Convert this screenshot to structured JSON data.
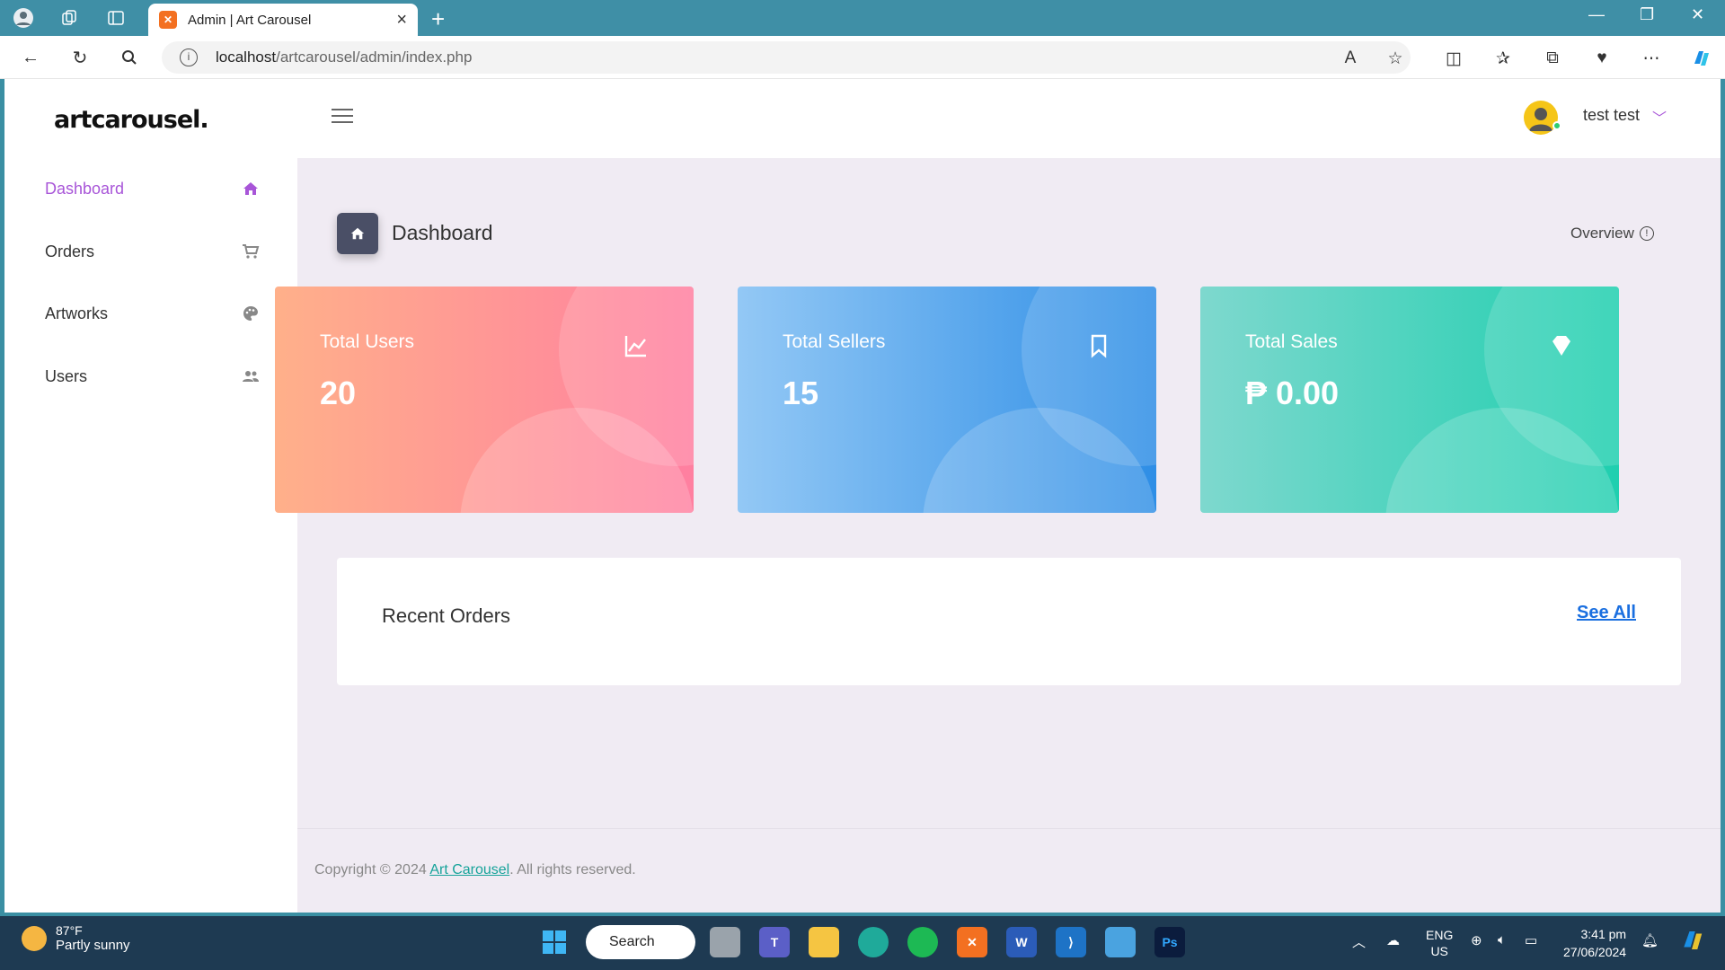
{
  "browser": {
    "tab_title": "Admin | Art Carousel",
    "url_host": "localhost",
    "url_path": "/artcarousel/admin/index.php"
  },
  "sidebar": {
    "logo": "artcarousel.",
    "items": [
      {
        "label": "Dashboard",
        "icon": "home-icon",
        "active": true
      },
      {
        "label": "Orders",
        "icon": "cart-icon",
        "active": false
      },
      {
        "label": "Artworks",
        "icon": "palette-icon",
        "active": false
      },
      {
        "label": "Users",
        "icon": "users-icon",
        "active": false
      }
    ]
  },
  "header": {
    "user_name": "test test"
  },
  "main": {
    "page_title": "Dashboard",
    "overview_label": "Overview",
    "cards": [
      {
        "label": "Total Users",
        "value": "20",
        "icon": "chart-line-icon",
        "gradient": [
          "#ffb08a",
          "#ff7fa0"
        ]
      },
      {
        "label": "Total Sellers",
        "value": "15",
        "icon": "bookmark-icon",
        "gradient": [
          "#93c8f5",
          "#2e8ee6"
        ]
      },
      {
        "label": "Total Sales",
        "value": "₱ 0.00",
        "icon": "diamond-icon",
        "gradient": [
          "#7ed8ce",
          "#1fcfaf"
        ]
      }
    ],
    "recent_orders_title": "Recent Orders",
    "see_all_label": "See All"
  },
  "footer": {
    "prefix": "Copyright © 2024 ",
    "link": "Art Carousel",
    "suffix": ". All rights reserved."
  },
  "taskbar": {
    "weather_temp": "87°F",
    "weather_desc": "Partly sunny",
    "search_label": "Search",
    "lang_top": "ENG",
    "lang_bottom": "US",
    "time": "3:41 pm",
    "date": "27/06/2024"
  },
  "colors": {
    "accent": "#a855d8",
    "link": "#1a6fe0",
    "footer_link": "#16a39a"
  }
}
